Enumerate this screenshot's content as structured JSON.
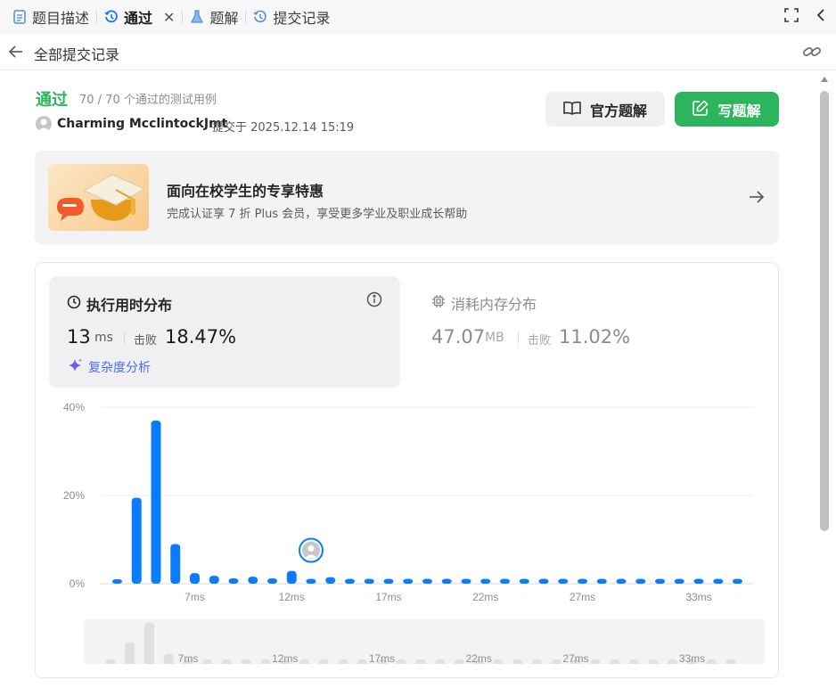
{
  "tabs": [
    {
      "label": "题目描述",
      "icon": "document-icon"
    },
    {
      "label": "通过",
      "icon": "history-icon",
      "active": true
    },
    {
      "label": "题解",
      "icon": "flask-icon"
    },
    {
      "label": "提交记录",
      "icon": "history-icon"
    }
  ],
  "header": {
    "back_label": "全部提交记录"
  },
  "submission": {
    "status": "通过",
    "passed_text": "70 / 70 个通过的测试用例",
    "author": "Charming McclintockJmt",
    "submitted_text": "提交于 2025.12.14 15:19"
  },
  "buttons": {
    "official": "官方题解",
    "write": "写题解"
  },
  "promo": {
    "title": "面向在校学生的专享特惠",
    "subtitle": "完成认证享 7 折 Plus 会员，享受更多学业及职业成长帮助"
  },
  "runtime": {
    "title": "执行用时分布",
    "value": "13",
    "unit": "ms",
    "beats_label": "击败",
    "beats_value": "18.47%",
    "complexity_label": "复杂度分析"
  },
  "memory": {
    "title": "消耗内存分布",
    "value": "47.07",
    "unit": "MB",
    "beats_label": "击败",
    "beats_value": "11.02%"
  },
  "colors": {
    "accent_green": "#2db55d",
    "bar_blue": "#0a7cff",
    "link_purple": "#4a6cf7"
  },
  "chart_data": {
    "type": "bar",
    "yticks": [
      "40%",
      "20%",
      "0%"
    ],
    "ylim": [
      0,
      40
    ],
    "x_labels": [
      "7ms",
      "12ms",
      "17ms",
      "22ms",
      "27ms",
      "33ms"
    ],
    "x_label_positions": [
      7,
      12,
      17,
      22,
      27,
      33
    ],
    "x": [
      3,
      4,
      5,
      6,
      7,
      8,
      9,
      10,
      11,
      12,
      13,
      14,
      15,
      16,
      17,
      18,
      19,
      20,
      21,
      22,
      23,
      24,
      25,
      26,
      27,
      28,
      29,
      30,
      31,
      32,
      33,
      34,
      35
    ],
    "values": [
      1.0,
      19.5,
      37.0,
      9.0,
      2.4,
      1.8,
      1.2,
      1.6,
      1.2,
      2.9,
      1.1,
      1.5,
      1.1,
      1.1,
      1.1,
      1.1,
      1.1,
      1.1,
      1.1,
      1.1,
      1.1,
      1.1,
      1.1,
      1.1,
      1.1,
      1.1,
      1.1,
      1.1,
      1.1,
      1.1,
      1.1,
      1.1,
      1.1
    ],
    "highlight_x": 13,
    "grid": true
  }
}
